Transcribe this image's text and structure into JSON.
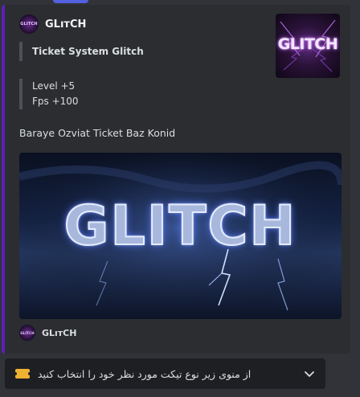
{
  "embed": {
    "accent_color": "#5b21b6",
    "author": {
      "name": "GLıтCH",
      "avatar_text": "GLITCH"
    },
    "thumbnail": {
      "text": "GLITCH"
    },
    "field_title": "Ticket System Glitch",
    "info_lines": [
      "Level +5",
      "Fps +100"
    ],
    "description": "Baraye Ozviat Ticket Baz Konid",
    "banner": {
      "text": "GLITCH"
    },
    "footer": {
      "name": "GLıтCH",
      "avatar_text": "GLITCH"
    }
  },
  "select_menu": {
    "icon": "ticket-icon",
    "placeholder": "از منوی زیر نوع تیکت مورد نظر خود را انتخاب کنید",
    "chevron": "chevron-down-icon"
  }
}
